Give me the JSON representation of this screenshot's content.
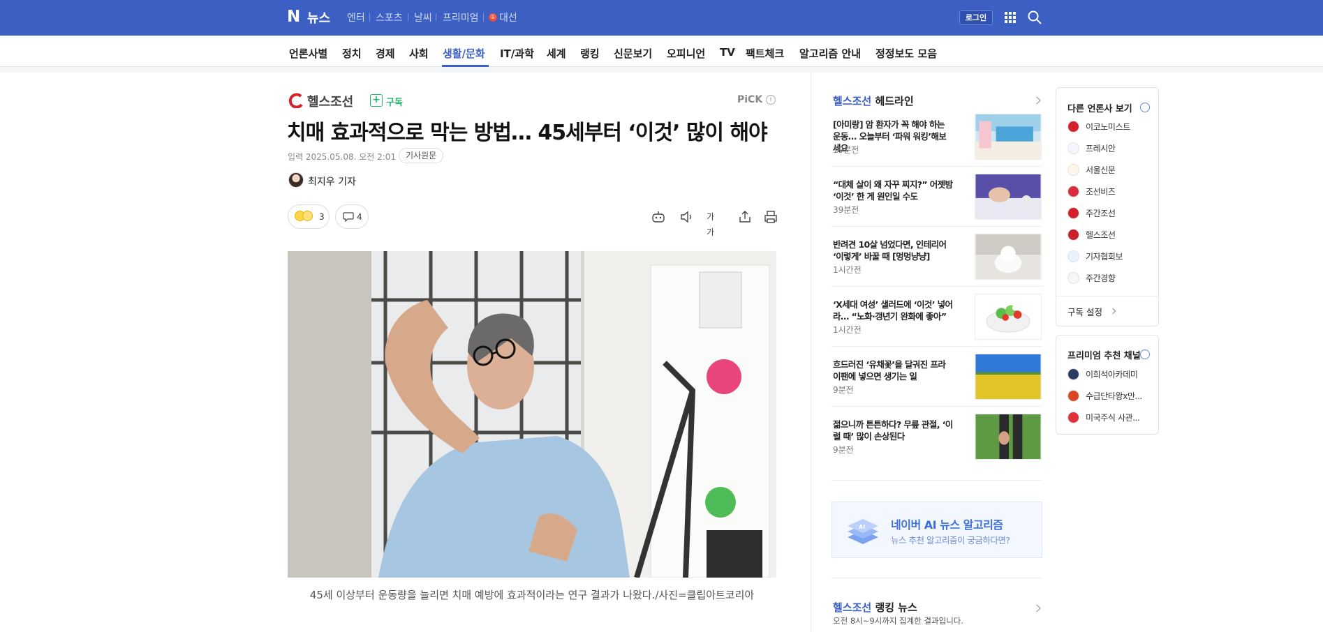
{
  "topbar": {
    "logo": "N",
    "service": "뉴스",
    "links": [
      "엔터",
      "스포츠",
      "날씨",
      "프리미엄",
      "대선"
    ],
    "election_mark": "①",
    "login": "로그인",
    "brand_color": "#3c5fc3"
  },
  "nav": {
    "items": [
      "언론사별",
      "정치",
      "경제",
      "사회",
      "생활/문화",
      "IT/과학",
      "세계",
      "랭킹",
      "신문보기",
      "오피니언",
      "TV",
      "팩트체크",
      "알고리즘 안내",
      "정정보도 모음"
    ],
    "active": "생활/문화"
  },
  "article": {
    "publisher": "헬스조선",
    "subscribe": "구독",
    "pick": "PiCK",
    "pick_info": "i",
    "title": "치매 효과적으로 막는 방법… 45세부터 ‘이것’ 많이 해야",
    "date_label": "입력 2025.05.08. 오전 2:01",
    "original_link": "기사원문",
    "reporter": "최지우 기자",
    "reaction_count": "3",
    "comment_count": "4",
    "font_size_label": "가가",
    "caption": "45세 이상부터 운동량을 늘리면 치매 예방에 효과적이라는 연구 결과가 나왔다./사진=클립아트코리아"
  },
  "headlines": {
    "publisher": "헬스조선",
    "label": "헤드라인",
    "items": [
      {
        "title": "[아미랑] 암 환자가 꼭 해야 하는 운동… 오늘부터 ‘파워 워킹’해보세요",
        "time": "19분전"
      },
      {
        "title": "“대체 살이 왜 자꾸 찌지?” 어젯밤 ‘이것’ 한 게 원인일 수도",
        "time": "39분전"
      },
      {
        "title": "반려견 10살 넘었다면, 인테리어 ‘이렇게’ 바꿀 때 [멍멍냥냥]",
        "time": "1시간전"
      },
      {
        "title": "‘X세대 여성’ 샐러드에 ‘이것’ 넣어라… “노화·갱년기 완화에 좋아”",
        "time": "1시간전"
      },
      {
        "title": "흐드러진 ‘유채꽃’을 달궈진 프라이팬에 넣으면 생기는 일",
        "time": "9분전"
      },
      {
        "title": "젊으니까 튼튼하다? 무릎 관절, ‘이럴 때’ 많이 손상된다",
        "time": "9분전"
      }
    ]
  },
  "ai_banner": {
    "title": "네이버 AI 뉴스 알고리즘",
    "subtitle": "뉴스 추천 알고리즘이 궁금하다면?",
    "badge": "AI"
  },
  "ranking": {
    "publisher": "헬스조선",
    "label": "랭킹 뉴스",
    "subtitle": "오전 8시~9시까지 집계한 결과입니다."
  },
  "other_press": {
    "title": "다른 언론사 보기",
    "items": [
      "이코노미스트",
      "프레시안",
      "서울신문",
      "조선비즈",
      "주간조선",
      "헬스조선",
      "기자협회보",
      "주간경향"
    ],
    "settings": "구독 설정"
  },
  "premium": {
    "title": "프리미엄 추천 채널",
    "items": [
      "이희석아카데미",
      "수급단타왕x만...",
      "미국주식 사관..."
    ]
  }
}
